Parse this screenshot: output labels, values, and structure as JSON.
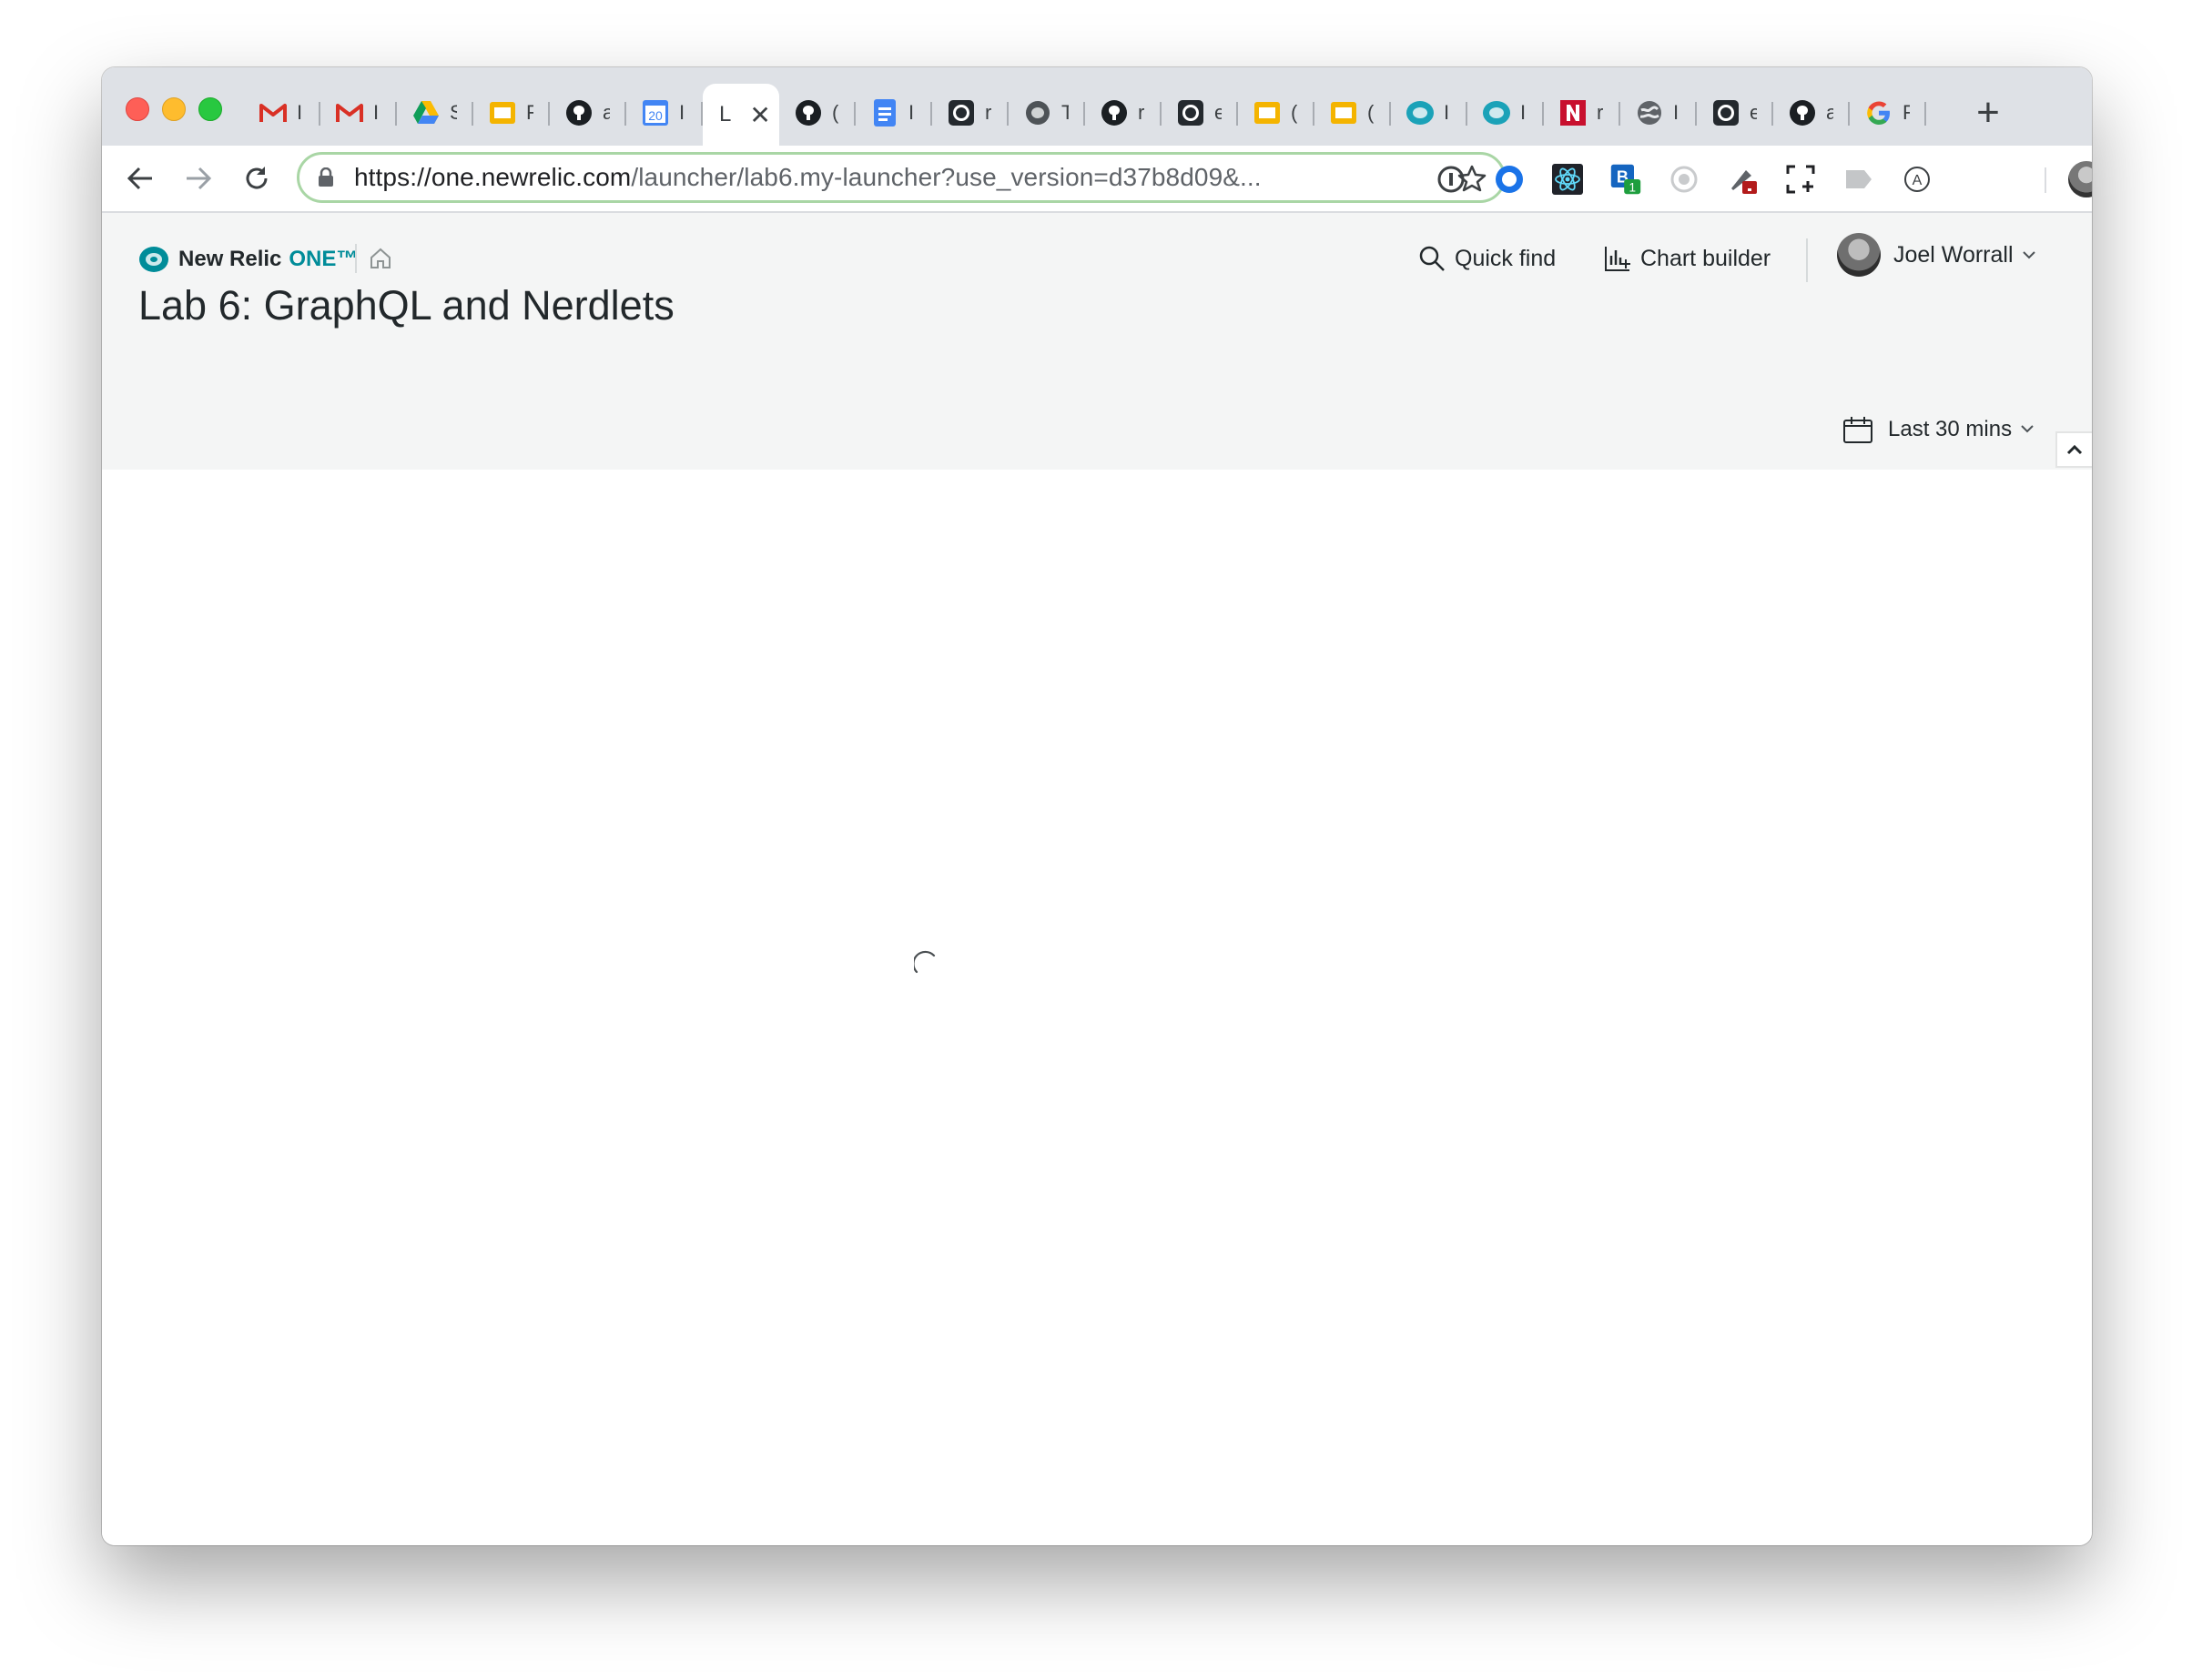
{
  "browser": {
    "tabs": [
      {
        "icon": "gmail-icon",
        "fragment": "I"
      },
      {
        "icon": "gmail-icon",
        "fragment": "I"
      },
      {
        "icon": "google-drive-icon",
        "fragment": "S"
      },
      {
        "icon": "google-slides-icon",
        "fragment": "F"
      },
      {
        "icon": "github-icon",
        "fragment": "a"
      },
      {
        "icon": "google-calendar-icon",
        "fragment": "I",
        "calendar_day": "20"
      },
      {
        "icon": "active-tab",
        "fragment": "L",
        "active": true
      },
      {
        "icon": "github-icon",
        "fragment": "("
      },
      {
        "icon": "google-docs-icon",
        "fragment": "I"
      },
      {
        "icon": "github-octocat-icon",
        "fragment": "r"
      },
      {
        "icon": "newrelic-gray-icon",
        "fragment": "T"
      },
      {
        "icon": "github-icon",
        "fragment": "r"
      },
      {
        "icon": "github-octocat-icon",
        "fragment": "e"
      },
      {
        "icon": "google-slides-icon",
        "fragment": "("
      },
      {
        "icon": "google-slides-icon",
        "fragment": "("
      },
      {
        "icon": "newrelic-teal-icon",
        "fragment": "I"
      },
      {
        "icon": "newrelic-teal-icon",
        "fragment": "I"
      },
      {
        "icon": "n-logo-red-icon",
        "fragment": "r"
      },
      {
        "icon": "globe-icon",
        "fragment": "I"
      },
      {
        "icon": "github-octocat-icon",
        "fragment": "e"
      },
      {
        "icon": "github-icon",
        "fragment": "a"
      },
      {
        "icon": "google-icon",
        "fragment": "F"
      }
    ],
    "new_tab_label": "+",
    "close_label": "✕",
    "url_host": "https://one.newrelic.com",
    "url_path": "/launcher/lab6.my-launcher?use_version=d37b8d09&...",
    "extension_badge": "1"
  },
  "app": {
    "brand": "New Relic",
    "brand_suffix": "ONE™",
    "quick_find": "Quick find",
    "chart_builder": "Chart builder",
    "user_name": "Joel Worrall",
    "page_title": "Lab 6: GraphQL and Nerdlets",
    "time_range": "Last 30 mins",
    "accent_color": "#008c99"
  }
}
